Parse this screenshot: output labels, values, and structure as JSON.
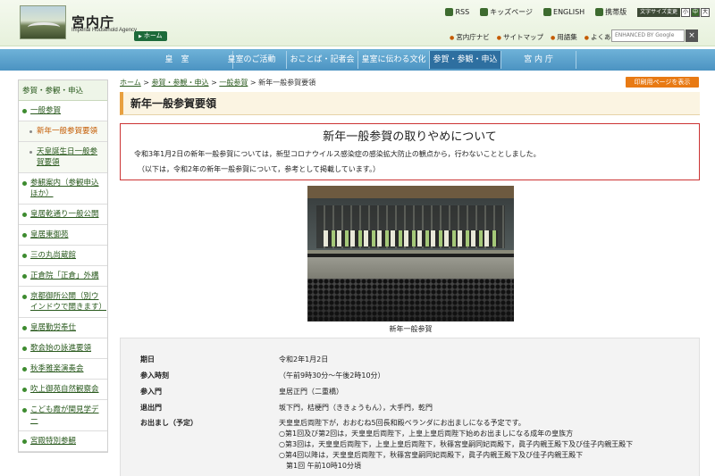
{
  "header": {
    "site_title": "宮内庁",
    "site_subtitle": "Imperial Household Agency",
    "home_label": "ホーム",
    "top_links": [
      "RSS",
      "キッズページ",
      "ENGLISH",
      "携帯版"
    ],
    "font_size_label": "文字サイズ変更",
    "font_sizes": [
      "小",
      "中",
      "大"
    ],
    "sub_links": [
      "宮内庁ナビ",
      "サイトマップ",
      "用語集",
      "よくある質問"
    ],
    "search_placeholder": "ENHANCED BY Google",
    "search_button": "×"
  },
  "nav": {
    "items": [
      "皇　室",
      "皇室のご活動",
      "おことば・記者会見",
      "皇室に伝わる文化",
      "参賀・参観・申込",
      "宮 内 庁"
    ]
  },
  "sidebar": {
    "head": "参賀・参観・申込",
    "items": [
      {
        "label": "一般参賀",
        "type": "main"
      },
      {
        "label": "新年一般参賀要領",
        "type": "sub current"
      },
      {
        "label": "天皇誕生日一般参賀要領",
        "type": "sub"
      },
      {
        "label": "参観案内（参観申込ほか）",
        "type": "main"
      },
      {
        "label": "皇居乾通り一般公開",
        "type": "main"
      },
      {
        "label": "皇居東御苑",
        "type": "main"
      },
      {
        "label": "三の丸尚蔵館",
        "type": "main"
      },
      {
        "label": "正倉院「正倉」外構",
        "type": "main"
      },
      {
        "label": "京都御所公開（別ウインドウで開きます）",
        "type": "main"
      },
      {
        "label": "皇居勤労奉仕",
        "type": "main"
      },
      {
        "label": "歌会始の詠進要領",
        "type": "main"
      },
      {
        "label": "秋季雅楽演奏会",
        "type": "main"
      },
      {
        "label": "吹上御苑自然観察会",
        "type": "main"
      },
      {
        "label": "こども霞が関見学デー",
        "type": "main"
      },
      {
        "label": "宮殿特別参観",
        "type": "main"
      }
    ]
  },
  "breadcrumb": [
    "ホーム",
    "参賀・参観・申込",
    "一般参賀",
    "新年一般参賀要領"
  ],
  "print_label": "印刷用ページを表示",
  "page_title": "新年一般参賀要領",
  "notice": {
    "title": "新年一般参賀の取りやめについて",
    "body": "令和3年1月2日の新年一般参賀については，新型コロナウイルス感染症の感染拡大防止の観点から，行わないこととしました。",
    "note": "（以下は，令和2年の新年一般参賀について，参考として掲載しています。）"
  },
  "photo_caption": "新年一般参賀",
  "info": {
    "rows": [
      {
        "key": "期日",
        "lines": [
          "令和2年1月2日"
        ]
      },
      {
        "key": "参入時刻",
        "lines": [
          "（午前9時30分～午後2時10分）"
        ]
      },
      {
        "key": "参入門",
        "lines": [
          "皇居正門（二重橋）"
        ]
      },
      {
        "key": "退出門",
        "lines": [
          "坂下門，桔梗門（ききょうもん），大手門，乾門"
        ]
      },
      {
        "key": "お出まし（予定）",
        "lines": [
          "天皇皇后両陛下が，おおむね5回長和殿ベランダにお出ましになる予定です。",
          "○第1回及び第2回は，天皇皇后両陛下，上皇上皇后両陛下始めお出ましになる成年の皇族方",
          "○第3回は，天皇皇后両陛下，上皇上皇后両陛下，秋篠宮皇嗣同妃両殿下，眞子内親王殿下及び佳子内親王殿下",
          "○第4回以降は，天皇皇后両陛下，秋篠宮皇嗣同妃両殿下，眞子内親王殿下及び佳子内親王殿下",
          "　第1回 午前10時10分頃"
        ]
      }
    ]
  }
}
